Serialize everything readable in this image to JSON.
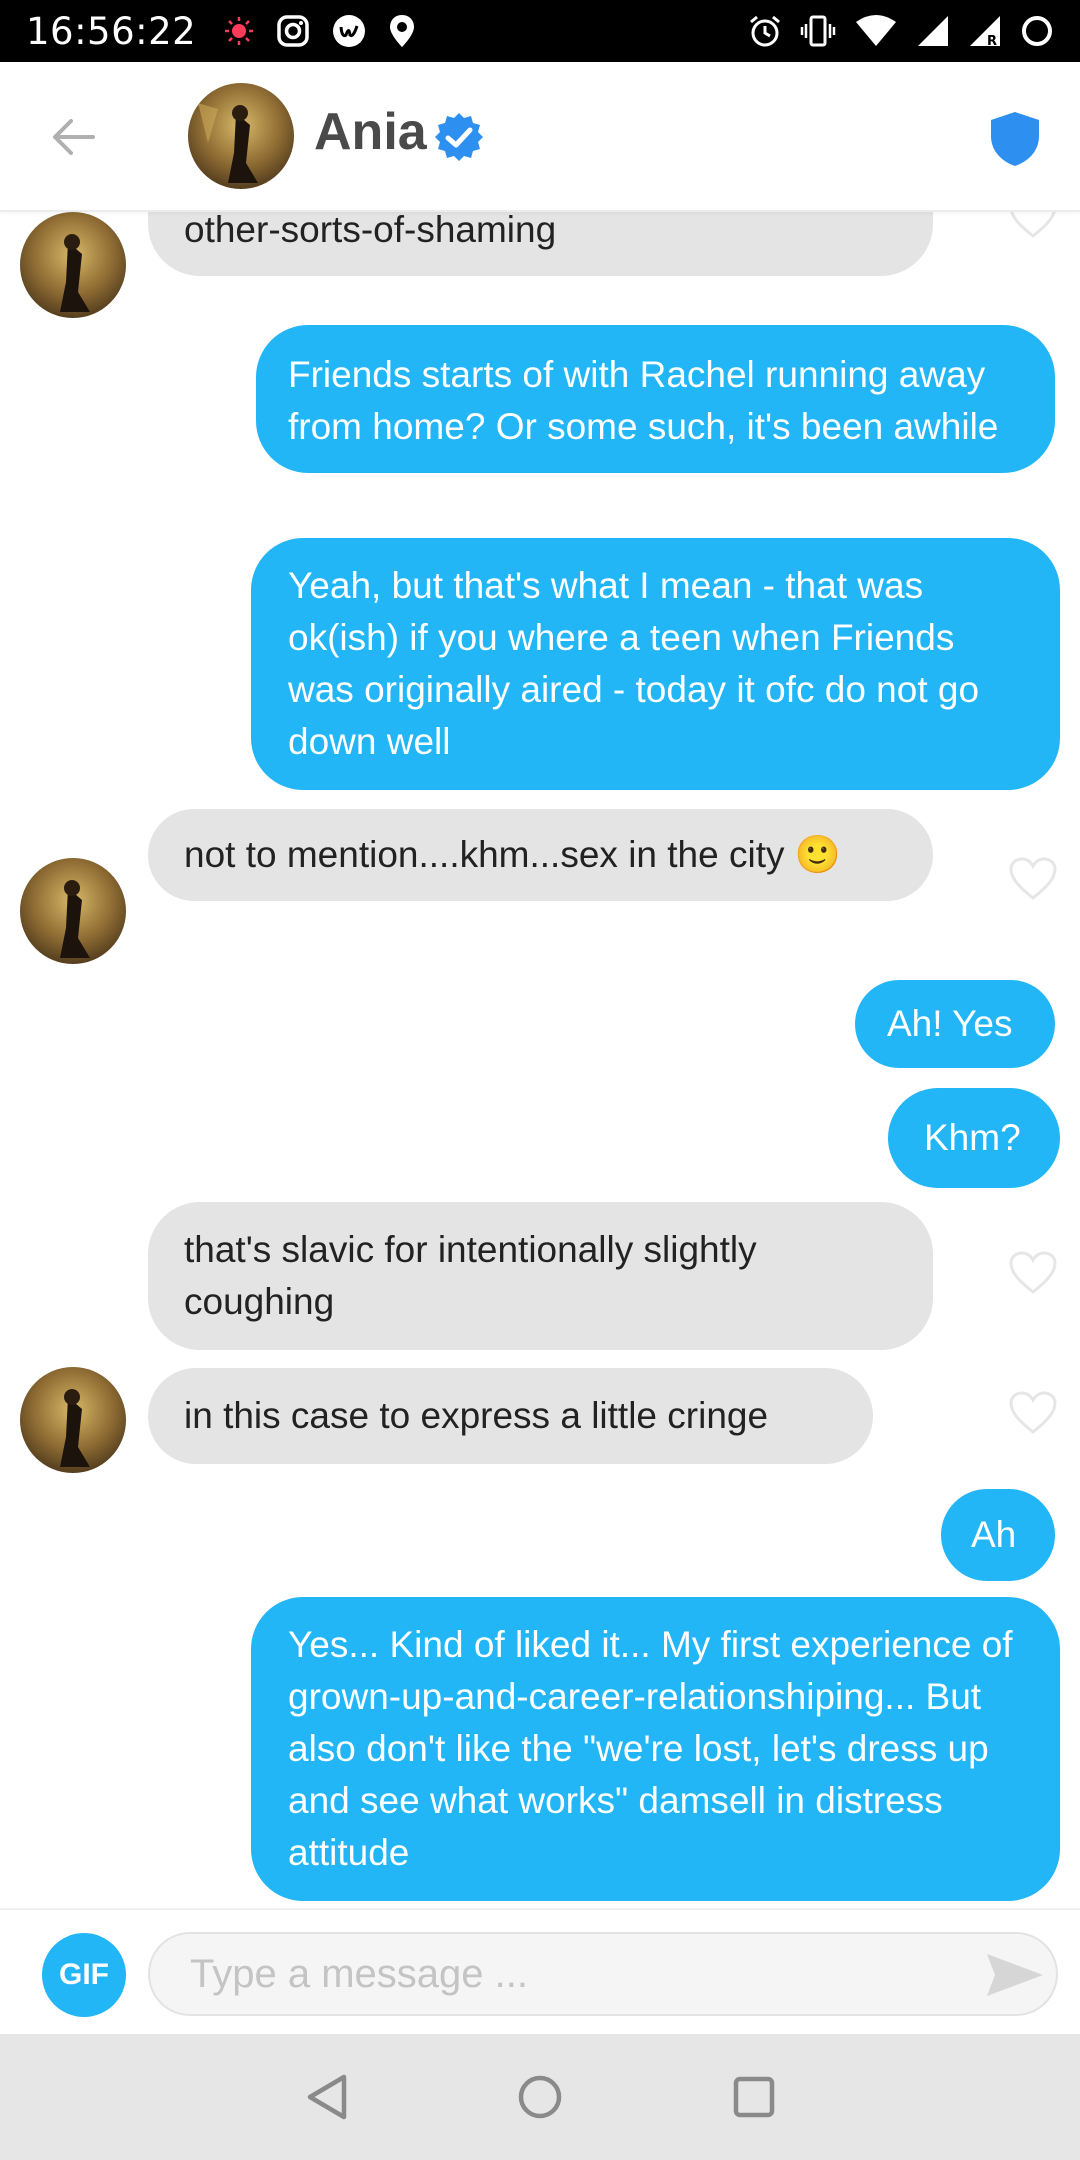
{
  "status_bar": {
    "time": "16:56:22",
    "icons": [
      "notification-dot-icon",
      "instagram-icon",
      "app-icon",
      "location-icon",
      "alarm-icon",
      "vibrate-icon",
      "wifi-icon",
      "signal-icon",
      "signal-roaming-icon",
      "circle-icon"
    ]
  },
  "header": {
    "name": "Ania",
    "verified": true,
    "icons": [
      "back-arrow-icon",
      "verified-badge-icon",
      "shield-icon"
    ]
  },
  "messages": [
    {
      "dir": "in",
      "text": "too much fat shaming, gay shaming, all-other-sorts-of-shaming"
    },
    {
      "dir": "out",
      "text": "Friends starts of with Rachel running away from home? Or some such, it's been awhile"
    },
    {
      "dir": "out",
      "text": "Yeah, but that's what I mean - that was ok(ish) if you where a teen when Friends was originally aired - today it ofc do not go down well"
    },
    {
      "dir": "in",
      "text": "not to mention....khm...sex in the city 🙂"
    },
    {
      "dir": "out",
      "text": "Ah! Yes"
    },
    {
      "dir": "out",
      "text": "Khm?"
    },
    {
      "dir": "in",
      "text": "that's slavic for intentionally slightly coughing"
    },
    {
      "dir": "in",
      "text": "in this case to express a little cringe"
    },
    {
      "dir": "out",
      "text": "Ah"
    },
    {
      "dir": "out",
      "text": "Yes... Kind of liked it... My first experience of grown-up-and-career-relationshiping... But also don't like the \"we're lost, let's dress up and see what works\" damsell in distress attitude"
    }
  ],
  "composer": {
    "gif_label": "GIF",
    "placeholder": "Type a message ..."
  },
  "colors": {
    "accent": "#22b6f7",
    "incoming_bubble": "#e4e4e4",
    "shield": "#2d8ff0"
  }
}
